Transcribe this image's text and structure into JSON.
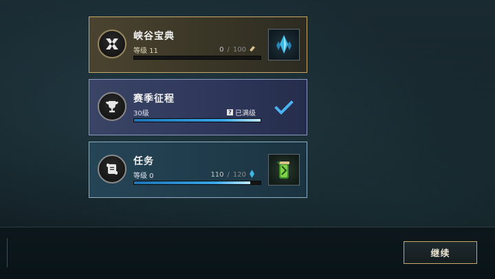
{
  "cards": {
    "pass": {
      "title": "峡谷宝典",
      "level_label": "等级 11",
      "progress_current": "0",
      "progress_sep": "/",
      "progress_max": "100",
      "progress_fraction": 0,
      "icon": "x-emblem-icon",
      "reward_icon": "crystal-icon",
      "accent": "#c8a96a"
    },
    "season": {
      "title": "赛季征程",
      "level_label": "30级",
      "status_icon_glyph": "?",
      "status_text": "已满级",
      "progress_fraction": 1,
      "icon": "trophy-icon",
      "complete_icon": "checkmark-icon",
      "accent": "#8f97c4"
    },
    "tasks": {
      "title": "任务",
      "level_label": "等级 0",
      "progress_current": "110",
      "progress_sep": "/",
      "progress_max": "120",
      "progress_fraction": 0.917,
      "icon": "scroll-icon",
      "reward_icon": "green-canister-icon",
      "accent": "#8fb0c4"
    }
  },
  "footer": {
    "continue_label": "继续"
  },
  "colors": {
    "blue_fill": "#37a6e8",
    "gold_border": "#c8a96a",
    "check_blue": "#4ab3f0"
  }
}
